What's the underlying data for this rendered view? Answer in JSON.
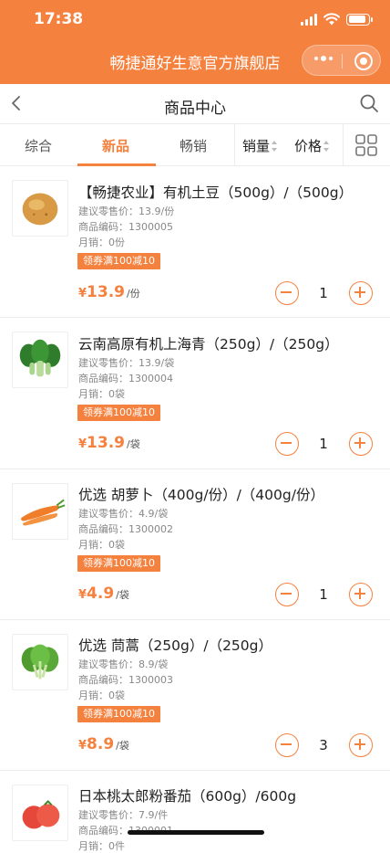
{
  "status_bar": {
    "time": "17:38"
  },
  "header": {
    "shop_name": "畅捷通好生意官方旗舰店"
  },
  "nav": {
    "title": "商品中心"
  },
  "tabs": [
    {
      "label": "综合",
      "active": false
    },
    {
      "label": "新品",
      "active": true
    },
    {
      "label": "畅销",
      "active": false
    },
    {
      "label": "销量",
      "active": false,
      "sortable": true
    },
    {
      "label": "价格",
      "active": false,
      "sortable": true
    }
  ],
  "colors": {
    "accent": "#f5813f"
  },
  "products": [
    {
      "name": "【畅捷农业】有机土豆（500g）/（500g）",
      "suggested": "建议零售价：13.9/份",
      "code": "商品编码：1300005",
      "monthly": "月销：0份",
      "coupon": "领券满100减10",
      "yen": "¥",
      "price": "13.9",
      "unit": "/份",
      "qty": "1",
      "image": "potato"
    },
    {
      "name": "云南高原有机上海青（250g）/（250g）",
      "suggested": "建议零售价：13.9/袋",
      "code": "商品编码：1300004",
      "monthly": "月销：0袋",
      "coupon": "领券满100减10",
      "yen": "¥",
      "price": "13.9",
      "unit": "/袋",
      "qty": "1",
      "image": "bok-choy"
    },
    {
      "name": "优选 胡萝卜（400g/份）/（400g/份）",
      "suggested": "建议零售价：4.9/袋",
      "code": "商品编码：1300002",
      "monthly": "月销：0袋",
      "coupon": "领券满100减10",
      "yen": "¥",
      "price": "4.9",
      "unit": "/袋",
      "qty": "1",
      "image": "carrot"
    },
    {
      "name": "优选 茼蒿（250g）/（250g）",
      "suggested": "建议零售价：8.9/袋",
      "code": "商品编码：1300003",
      "monthly": "月销：0袋",
      "coupon": "领券满100减10",
      "yen": "¥",
      "price": "8.9",
      "unit": "/袋",
      "qty": "3",
      "image": "greens"
    },
    {
      "name": "日本桃太郎粉番茄（600g）/600g",
      "suggested": "建议零售价：7.9/件",
      "code": "商品编码：1300001",
      "monthly": "月销：0件",
      "image": "tomato"
    }
  ]
}
